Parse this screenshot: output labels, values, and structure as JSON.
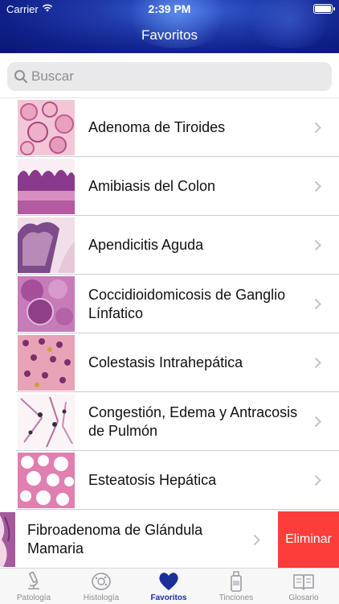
{
  "status": {
    "carrier": "Carrier",
    "time": "2:39 PM"
  },
  "nav": {
    "title": "Favoritos"
  },
  "search": {
    "placeholder": "Buscar"
  },
  "items": [
    {
      "label": "Adenoma de Tiroides"
    },
    {
      "label": "Amibiasis del Colon"
    },
    {
      "label": "Apendicitis Aguda"
    },
    {
      "label": "Coccidioidomicosis de Ganglio Línfatico"
    },
    {
      "label": "Colestasis Intrahepática"
    },
    {
      "label": "Congestión, Edema y Antracosis de Pulmón"
    },
    {
      "label": "Esteatosis Hepática"
    }
  ],
  "swiped_item": {
    "label": "Fibroadenoma de Glándula Mamaria",
    "delete_label": "Eliminar"
  },
  "tabs": [
    {
      "label": "Patología",
      "icon": "microscope-icon"
    },
    {
      "label": "Histología",
      "icon": "cell-icon"
    },
    {
      "label": "Favoritos",
      "icon": "heart-icon",
      "active": true
    },
    {
      "label": "Tinciones",
      "icon": "bottle-icon"
    },
    {
      "label": "Glosario",
      "icon": "book-icon"
    }
  ],
  "colors": {
    "header": "#1f3aa8",
    "active_tab": "#1a2f9c",
    "delete": "#fc3d39",
    "separator": "#c9cbd6"
  }
}
